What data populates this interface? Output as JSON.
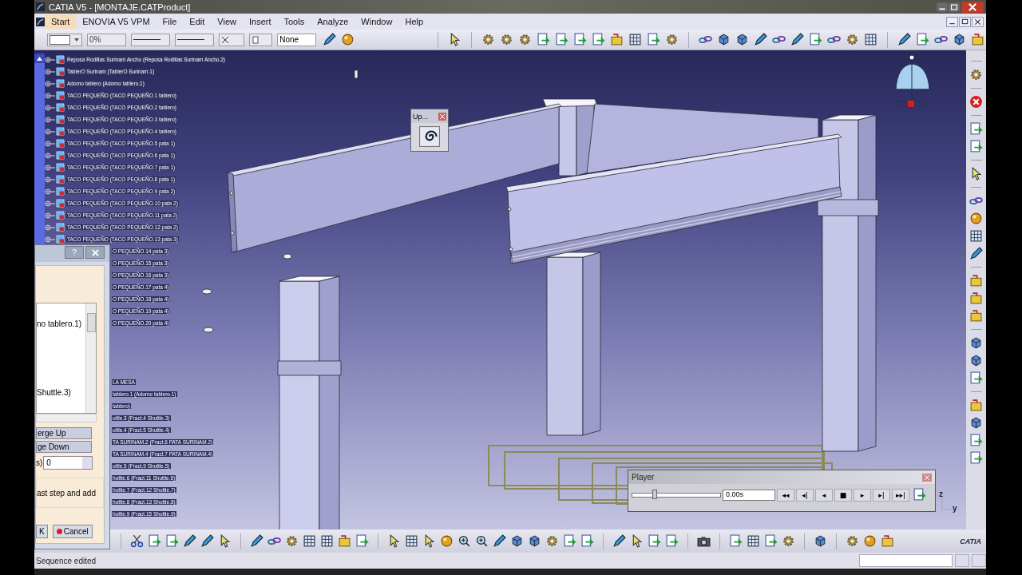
{
  "window": {
    "title": "CATIA V5 - [MONTAJE.CATProduct]"
  },
  "menu": [
    {
      "label": "Start",
      "selected": true
    },
    {
      "label": "ENOVIA V5 VPM",
      "selected": false
    },
    {
      "label": "File",
      "selected": false
    },
    {
      "label": "Edit",
      "selected": false
    },
    {
      "label": "View",
      "selected": false
    },
    {
      "label": "Insert",
      "selected": false
    },
    {
      "label": "Tools",
      "selected": false
    },
    {
      "label": "Analyze",
      "selected": false
    },
    {
      "label": "Window",
      "selected": false
    },
    {
      "label": "Help",
      "selected": false
    }
  ],
  "format_toolbar": {
    "transparency": "0%",
    "layer": "None"
  },
  "tree": {
    "items": [
      "Reposa Rodillas Surinam Ancho (Reposa Rodillas Surinam Ancho.2)",
      "TablerO Surinam (TablerO Surinam.1)",
      "Adorno tablero (Adorno tablero.1)",
      "TACO PEQUEÑO (TACO PEQUEÑO.1 tablero)",
      "TACO PEQUEÑO (TACO PEQUEÑO.2 tablero)",
      "TACO PEQUEÑO (TACO PEQUEÑO.3 tablero)",
      "TACO PEQUEÑO (TACO PEQUEÑO.4 tablero)",
      "TACO PEQUEÑO (TACO PEQUEÑO.5 pata 1)",
      "TACO PEQUEÑO (TACO PEQUEÑO.6 pata 1)",
      "TACO PEQUEÑO (TACO PEQUEÑO.7 pata 1)",
      "TACO PEQUEÑO (TACO PEQUEÑO.8 pata 1)",
      "TACO PEQUEÑO (TACO PEQUEÑO.9 pata 2)",
      "TACO PEQUEÑO (TACO PEQUEÑO.10 pata 2)",
      "TACO PEQUEÑO (TACO PEQUEÑO.11 pata 2)",
      "TACO PEQUEÑO (TACO PEQUEÑO.12 pata 2)",
      "TACO PEQUEÑO (TACO PEQUEÑO.13 pata 3)"
    ],
    "covered_items": [
      "O PEQUEÑO.14 pata 3)",
      "O PEQUEÑO.15 pata 3)",
      "O PEQUEÑO.16 pata 3)",
      "O PEQUEÑO.17 pata 4)",
      "O PEQUEÑO.18 pata 4)",
      "O PEQUEÑO.19 pata 4)",
      "O PEQUEÑO.20 pata 4)"
    ],
    "lower_items": [
      "LA MESA",
      "tablero.1 (Adorno tablero.1)",
      "tablero)",
      "uttle.3 (Fract.4 Shuttle.3)",
      "uttle.4 (Fract.5 Shuttle.4)",
      "TA SURINAM.2 (Fract.6 PATA SURINAM.2)",
      "TA SURINAM.4 (Fract.7 PATA SURINAM.4)",
      "uttle.5 (Fract.9 Shuttle.5)",
      "huttle.6 (Fract.11 Shuttle.6)",
      "huttle.7 (Fract.12 Shuttle.7)",
      "huttle.8 (Fract.13 Shuttle.8)",
      "huttle.9 (Fract.15 Shuttle.9)"
    ]
  },
  "up_dialog": {
    "title": "Up..."
  },
  "step_dialog": {
    "help": "?",
    "list": [
      "no tablero.1)",
      "Shuttle.3)"
    ],
    "buttons": [
      "erge Up",
      "ge Down"
    ],
    "spin_label": "s)",
    "spin_value": "0",
    "option": "ast step and add",
    "ok": "K",
    "cancel": "Cancel"
  },
  "player": {
    "title": "Player",
    "level": 0.25,
    "time": "0.00s",
    "controls": [
      "◂◂",
      "◂|",
      "◂",
      "■",
      "▸",
      "▸|",
      "▸▸|"
    ]
  },
  "axis": {
    "labels": [
      "z",
      "y"
    ]
  },
  "brand": "CATIA",
  "status_bar": {
    "message": "Sequence edited"
  }
}
